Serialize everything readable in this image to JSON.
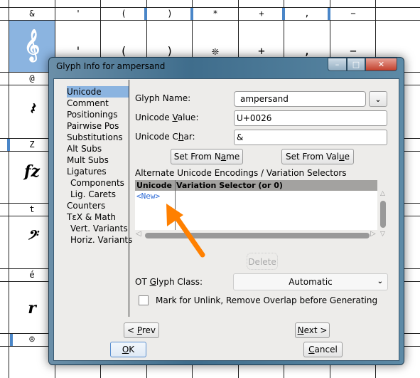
{
  "background_grid": {
    "top_labels": [
      "&",
      "'",
      "(",
      ")",
      "*",
      "+",
      ",",
      "−"
    ],
    "top_glyphs": [
      "'",
      "(",
      ")",
      "❊",
      "+",
      ",",
      "−"
    ],
    "left_labels": [
      "@",
      "Z",
      "t",
      "é",
      "®"
    ],
    "left_glyphs": [
      "𝄞",
      "𝄽",
      "fz",
      "𝄢",
      "r"
    ],
    "accent_color": "#4a86c8",
    "selected_color": "#8bb4e0"
  },
  "dialog": {
    "title": "Glyph Info for ampersand",
    "window_buttons": {
      "minimize": "–",
      "maximize": "□",
      "close": "✕"
    },
    "sidebar": {
      "selected": "Unicode",
      "items": [
        "Unicode",
        "Comment",
        "Positionings",
        "Pairwise Pos",
        "Substitutions",
        "Alt Subs",
        "Mult Subs",
        "Ligatures",
        " Components",
        " Lig. Carets",
        "Counters",
        "TεX & Math",
        " Vert. Variants",
        " Horiz. Variants"
      ]
    },
    "glyph_name_label": "Glyph Name:",
    "glyph_name_value": "ampersand",
    "unicode_value_label": "Unicode Value:",
    "unicode_value": "U+0026",
    "unicode_char_label": "Unicode Char:",
    "unicode_char": "&",
    "set_from_name": "Set From Name",
    "set_from_value": "Set From Value",
    "alt_label": "Alternate Unicode Encodings / Variation Selectors",
    "table": {
      "headers": [
        "Unicode",
        "Variation Selector (or 0)"
      ],
      "rows": [
        [
          "<New>",
          ""
        ]
      ]
    },
    "delete_label": "Delete",
    "ot_class_label": "OT Glyph Class:",
    "ot_class_value": "Automatic",
    "mark_unlink_label": "Mark for Unlink, Remove Overlap before Generating",
    "mark_unlink_checked": false,
    "prev_label": "< Prev",
    "next_label": "Next >",
    "ok_label": "OK",
    "cancel_label": "Cancel",
    "annotation_arrow_color": "#ff8000"
  }
}
